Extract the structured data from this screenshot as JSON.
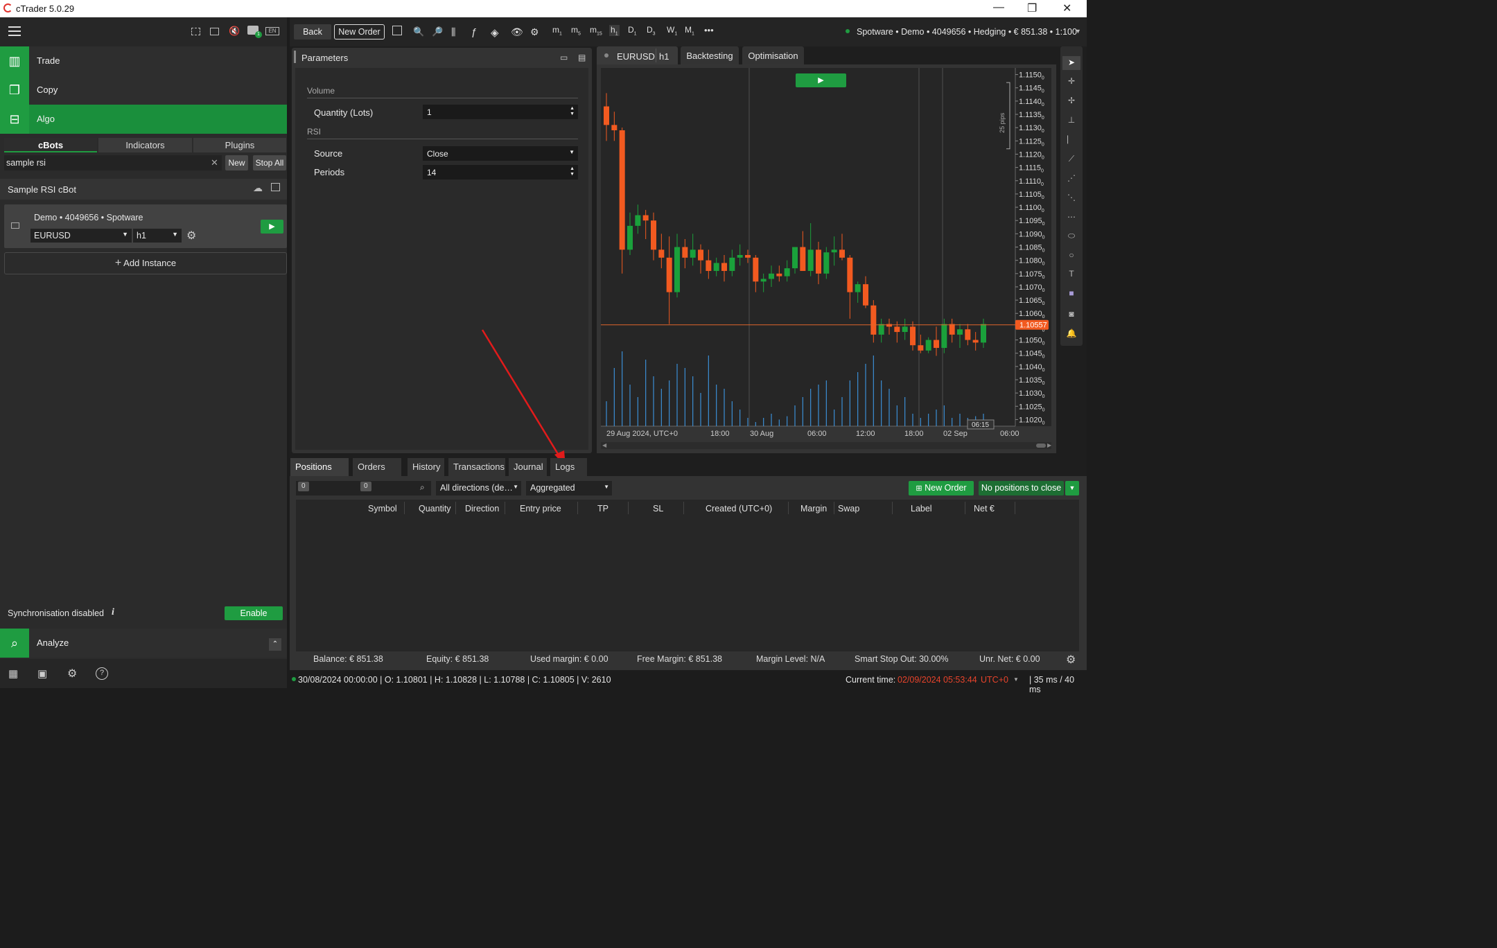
{
  "window": {
    "title": "cTrader 5.0.29",
    "minimize": "—",
    "maximize": "❐",
    "close": "✕"
  },
  "left": {
    "nav": [
      {
        "label": "Trade",
        "icon": "trade-icon"
      },
      {
        "label": "Copy",
        "icon": "copy-icon"
      },
      {
        "label": "Algo",
        "icon": "algo-icon"
      }
    ],
    "tabs": [
      "cBots",
      "Indicators",
      "Plugins"
    ],
    "search": {
      "value": "sample rsi",
      "clear": "✕"
    },
    "new_label": "New",
    "stopall_label": "Stop All",
    "bot_name": "Sample RSI cBot",
    "instance": {
      "account": "Demo • 4049656 •  Spotware",
      "symbol": "EURUSD",
      "timeframe": "h1"
    },
    "add_instance": "Add Instance",
    "sync_text": "Synchronisation disabled",
    "sync_info": "i",
    "enable_label": "Enable",
    "analyze_label": "Analyze"
  },
  "toolbar": {
    "back": "Back",
    "new_order": "New Order",
    "more": "•••",
    "timeframes": [
      {
        "m": "m",
        "s": "1"
      },
      {
        "m": "m",
        "s": "5"
      },
      {
        "m": "m",
        "s": "15"
      },
      {
        "m": "h",
        "s": "1"
      },
      {
        "m": "D",
        "s": "1"
      },
      {
        "m": "D",
        "s": "3"
      },
      {
        "m": "W",
        "s": "1"
      },
      {
        "m": "M",
        "s": "1"
      }
    ],
    "account": "Spotware • Demo • 4049656 • Hedging • € 851.38 • 1:100"
  },
  "params": {
    "title": "Parameters",
    "groups": [
      {
        "name": "Volume"
      },
      {
        "name": "RSI"
      }
    ],
    "rows": [
      {
        "label": "Quantity (Lots)",
        "value": "1"
      },
      {
        "label": "Source",
        "value": "Close"
      },
      {
        "label": "Periods",
        "value": "14"
      }
    ]
  },
  "chart_tabs": {
    "symbol": "EURUSD",
    "tf": "h1",
    "backtesting": "Backtesting",
    "optimisation": "Optimisation"
  },
  "chart_data": {
    "type": "candlestick",
    "symbol": "EURUSD",
    "timeframe": "h1",
    "y_ticks": [
      "1.1150",
      "1.1145",
      "1.1140",
      "1.1135",
      "1.1130",
      "1.1125",
      "1.1120",
      "1.1115",
      "1.1110",
      "1.1105",
      "1.1100",
      "1.1095",
      "1.1090",
      "1.1085",
      "1.1080",
      "1.1075",
      "1.1070",
      "1.1065",
      "1.1060",
      "1.1055",
      "1.1050",
      "1.1045",
      "1.1040",
      "1.1035",
      "1.1030",
      "1.1025",
      "1.1020"
    ],
    "tick_subscript": "0",
    "x_ticks": [
      "29 Aug 2024, UTC+0",
      "18:00",
      "30 Aug",
      "06:00",
      "12:00",
      "18:00",
      "02 Sep",
      "06:00"
    ],
    "ylim": [
      1.10175,
      1.11525
    ],
    "current_price": "1.10557",
    "pips_label": "25 pips",
    "countdown": "06:15",
    "candles": [
      [
        1.1138,
        1.1143,
        1.1125,
        1.1131
      ],
      [
        1.1131,
        1.1136,
        1.1125,
        1.1129
      ],
      [
        1.1129,
        1.113,
        1.1075,
        1.1084
      ],
      [
        1.1084,
        1.1098,
        1.1082,
        1.1093
      ],
      [
        1.1093,
        1.1101,
        1.109,
        1.1097
      ],
      [
        1.1097,
        1.1099,
        1.1088,
        1.1095
      ],
      [
        1.1095,
        1.1098,
        1.108,
        1.1084
      ],
      [
        1.1084,
        1.109,
        1.1077,
        1.1081
      ],
      [
        1.1081,
        1.1089,
        1.1056,
        1.1068
      ],
      [
        1.1068,
        1.109,
        1.1066,
        1.1085
      ],
      [
        1.1085,
        1.1088,
        1.1077,
        1.1081
      ],
      [
        1.1081,
        1.109,
        1.1078,
        1.1084
      ],
      [
        1.1084,
        1.1086,
        1.1075,
        1.108
      ],
      [
        1.108,
        1.1084,
        1.1073,
        1.1076
      ],
      [
        1.1076,
        1.1081,
        1.1074,
        1.1079
      ],
      [
        1.1079,
        1.1082,
        1.1072,
        1.1076
      ],
      [
        1.1076,
        1.1084,
        1.1074,
        1.1081
      ],
      [
        1.1081,
        1.1086,
        1.1078,
        1.1082
      ],
      [
        1.1082,
        1.1084,
        1.1079,
        1.1081
      ],
      [
        1.1081,
        1.1082,
        1.1068,
        1.1072
      ],
      [
        1.1072,
        1.1075,
        1.1068,
        1.1073
      ],
      [
        1.1073,
        1.1078,
        1.107,
        1.1075
      ],
      [
        1.1075,
        1.1078,
        1.1072,
        1.1074
      ],
      [
        1.1074,
        1.108,
        1.1072,
        1.1077
      ],
      [
        1.1077,
        1.1082,
        1.1075,
        1.1085
      ],
      [
        1.1085,
        1.1091,
        1.1076,
        1.1076
      ],
      [
        1.1076,
        1.1094,
        1.1074,
        1.1084
      ],
      [
        1.1084,
        1.1087,
        1.1071,
        1.1075
      ],
      [
        1.1075,
        1.1085,
        1.1073,
        1.1083
      ],
      [
        1.1083,
        1.1089,
        1.1078,
        1.1084
      ],
      [
        1.1084,
        1.109,
        1.108,
        1.1081
      ],
      [
        1.1081,
        1.1082,
        1.1058,
        1.1068
      ],
      [
        1.1068,
        1.1072,
        1.1064,
        1.1071
      ],
      [
        1.1071,
        1.1074,
        1.1062,
        1.1063
      ],
      [
        1.1063,
        1.1065,
        1.1049,
        1.1052
      ],
      [
        1.1052,
        1.1058,
        1.1049,
        1.1056
      ],
      [
        1.1056,
        1.1058,
        1.1052,
        1.1055
      ],
      [
        1.1055,
        1.1057,
        1.1049,
        1.1053
      ],
      [
        1.1053,
        1.1058,
        1.105,
        1.1055
      ],
      [
        1.1055,
        1.1057,
        1.1046,
        1.1048
      ],
      [
        1.1048,
        1.1052,
        1.1045,
        1.1046
      ],
      [
        1.1046,
        1.1051,
        1.1045,
        1.105
      ],
      [
        1.105,
        1.1055,
        1.1044,
        1.1047
      ],
      [
        1.1047,
        1.1058,
        1.1045,
        1.1056
      ],
      [
        1.1056,
        1.1058,
        1.1049,
        1.1052
      ],
      [
        1.1052,
        1.1056,
        1.1047,
        1.1054
      ],
      [
        1.1054,
        1.1056,
        1.1048,
        1.105
      ],
      [
        1.105,
        1.1053,
        1.1046,
        1.1049
      ],
      [
        1.1049,
        1.1058,
        1.1047,
        1.1056
      ]
    ],
    "volumes": [
      0.3,
      0.7,
      0.9,
      0.5,
      0.35,
      0.8,
      0.6,
      0.45,
      0.55,
      0.75,
      0.7,
      0.6,
      0.4,
      0.85,
      0.5,
      0.45,
      0.3,
      0.2,
      0.1,
      0.05,
      0.1,
      0.15,
      0.08,
      0.12,
      0.25,
      0.35,
      0.45,
      0.5,
      0.55,
      0.2,
      0.35,
      0.55,
      0.65,
      0.75,
      0.85,
      0.55,
      0.45,
      0.25,
      0.35,
      0.15,
      0.1,
      0.15,
      0.2,
      0.25,
      0.1,
      0.15,
      0.1,
      0.12,
      0.15
    ]
  },
  "bottom": {
    "tabs": [
      {
        "label": "Positions",
        "count": "0"
      },
      {
        "label": "Orders",
        "count": "0"
      },
      {
        "label": "History"
      },
      {
        "label": "Transactions"
      },
      {
        "label": "Journal"
      },
      {
        "label": "Logs"
      }
    ],
    "directions": "All directions (de…",
    "aggregated": "Aggregated",
    "new_order": "New Order",
    "no_positions": "No positions to close",
    "columns": [
      "Symbol",
      "Quantity",
      "Direction",
      "Entry price",
      "TP",
      "SL",
      "Created (UTC+0)",
      "Margin",
      "Swap",
      "Label",
      "Net €"
    ],
    "status": [
      "Balance: € 851.38",
      "Equity: € 851.38",
      "Used margin: € 0.00",
      "Free Margin: € 851.38",
      "Margin Level: N/A",
      "Smart Stop Out: 30.00%",
      "Unr. Net: € 0.00"
    ]
  },
  "footer": {
    "ohlc": "30/08/2024 00:00:00 |  O: 1.10801 |  H: 1.10828 |  L: 1.10788 |  C: 1.10805 |  V: 2610",
    "current_time_label": "Current time:",
    "current_time": "02/09/2024 05:53:44",
    "tz": "UTC+0",
    "latency": "| 35 ms / 40 ms"
  },
  "colors": {
    "accent": "#1f9c41",
    "bull": "#1aa13b",
    "bear": "#f25a20",
    "price_line": "#e0672b",
    "arrow": "#e11b1b"
  }
}
